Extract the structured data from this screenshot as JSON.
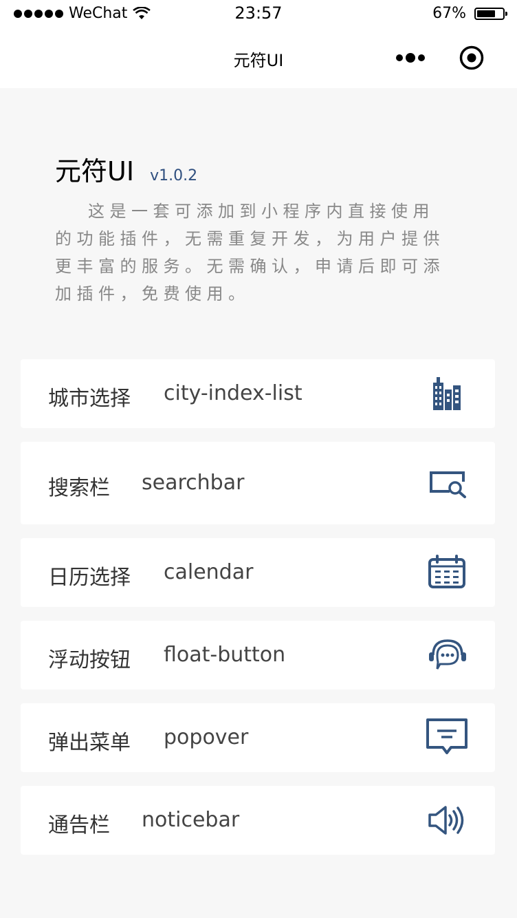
{
  "status": {
    "carrier": "WeChat",
    "time": "23:57",
    "battery": "67%",
    "battery_level": 0.67
  },
  "nav": {
    "title": "元符UI",
    "more_icon": "more-dots-icon",
    "close_icon": "target-close-icon"
  },
  "intro": {
    "title": "元符UI",
    "version": "v1.0.2",
    "description": "这是一套可添加到小程序内直接使用的功能插件，无需重复开发，为用户提供更丰富的服务。无需确认，申请后即可添加插件，免费使用。"
  },
  "items": [
    {
      "cn": "城市选择",
      "en": "city-index-list",
      "icon": "city-buildings-icon"
    },
    {
      "cn": "搜索栏",
      "en": "searchbar",
      "icon": "search-window-icon"
    },
    {
      "cn": "日历选择",
      "en": "calendar",
      "icon": "calendar-icon"
    },
    {
      "cn": "浮动按钮",
      "en": "float-button",
      "icon": "headset-chat-icon"
    },
    {
      "cn": "弹出菜单",
      "en": "popover",
      "icon": "message-box-icon"
    },
    {
      "cn": "通告栏",
      "en": "noticebar",
      "icon": "speaker-icon"
    }
  ],
  "colors": {
    "accent": "#2f4f7f",
    "icon": "#34557f",
    "background": "#f7f7f7"
  }
}
